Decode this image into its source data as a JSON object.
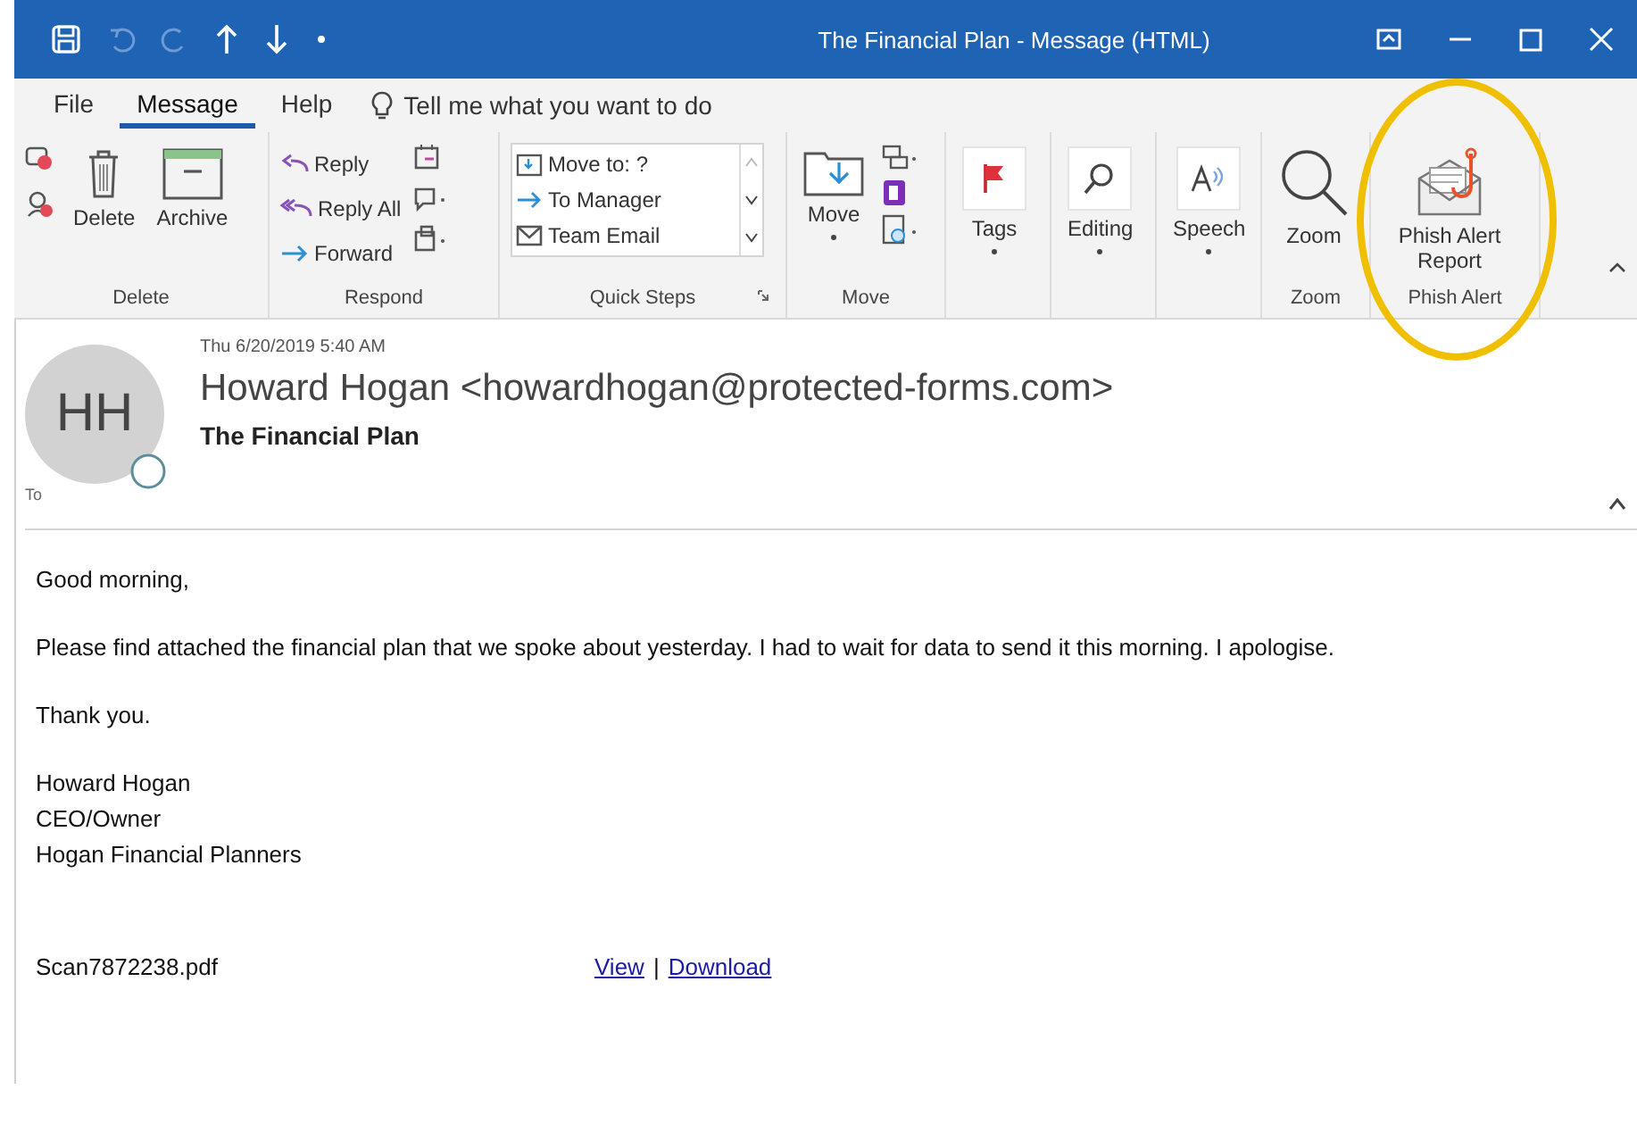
{
  "window": {
    "title": "The Financial Plan - Message (HTML)"
  },
  "tabs": [
    {
      "label": "File",
      "selected": false
    },
    {
      "label": "Message",
      "selected": true
    },
    {
      "label": "Help",
      "selected": false
    }
  ],
  "tell_me": {
    "placeholder": "Tell me what you want to do"
  },
  "ribbon": {
    "groups": [
      {
        "kind": "delete",
        "label": "Delete",
        "buttons": [
          "Delete",
          "Archive"
        ]
      },
      {
        "kind": "respond",
        "label": "Respond",
        "buttons": [
          "Reply",
          "Reply All",
          "Forward"
        ]
      },
      {
        "kind": "quicksteps",
        "label": "Quick Steps",
        "buttons": [
          "Move to: ?",
          "To Manager",
          "Team Email"
        ]
      },
      {
        "kind": "move",
        "label": "Move",
        "buttons": [
          "Move"
        ]
      },
      {
        "kind": "single",
        "buttons": [
          "Tags"
        ]
      },
      {
        "kind": "single",
        "buttons": [
          "Editing"
        ]
      },
      {
        "kind": "single",
        "buttons": [
          "Speech"
        ]
      },
      {
        "kind": "zoom",
        "label": "Zoom",
        "buttons": [
          "Zoom"
        ]
      },
      {
        "kind": "addin",
        "label": "Phish Alert",
        "buttons": [
          "Phish Alert Report"
        ]
      }
    ]
  },
  "message": {
    "date": "Thu 6/20/2019 5:40 AM",
    "avatar": "HH",
    "sender": "Howard Hogan <howardhogan@protected-forms.com>",
    "subject": "The Financial Plan",
    "to_label": "To",
    "paragraphs": [
      "Good morning,",
      "Please find attached the financial plan that we spoke about yesterday. I had to wait for data to send it this morning. I apologise.",
      "Thank you."
    ],
    "signature": [
      "Howard Hogan",
      "CEO/Owner",
      "Hogan Financial Planners"
    ],
    "attachment": {
      "filename": "Scan7872238.pdf",
      "links": [
        "View",
        "Download"
      ],
      "separator": "|"
    }
  }
}
